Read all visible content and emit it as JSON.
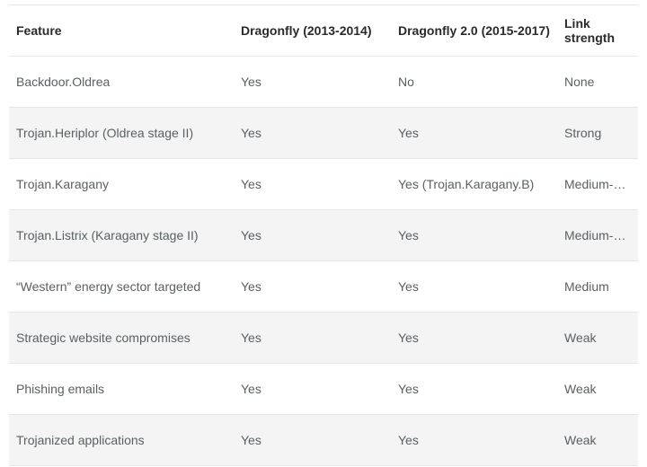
{
  "chart_data": {
    "type": "table",
    "title": "",
    "columns": [
      "Feature",
      "Dragonfly (2013-2014)",
      "Dragonfly 2.0 (2015-2017)",
      "Link strength"
    ],
    "rows": [
      [
        "Backdoor.Oldrea",
        "Yes",
        "No",
        "None"
      ],
      [
        "Trojan.Heriplor (Oldrea stage II)",
        "Yes",
        "Yes",
        "Strong"
      ],
      [
        "Trojan.Karagany",
        "Yes",
        "Yes (Trojan.Karagany.B)",
        "Medium-Strong"
      ],
      [
        "Trojan.Listrix (Karagany stage II)",
        "Yes",
        "Yes",
        "Medium-Strong"
      ],
      [
        "“Western” energy sector targeted",
        "Yes",
        "Yes",
        "Medium"
      ],
      [
        "Strategic website compromises",
        "Yes",
        "Yes",
        "Weak"
      ],
      [
        "Phishing emails",
        "Yes",
        "Yes",
        "Weak"
      ],
      [
        "Trojanized applications",
        "Yes",
        "Yes",
        "Weak"
      ]
    ]
  }
}
